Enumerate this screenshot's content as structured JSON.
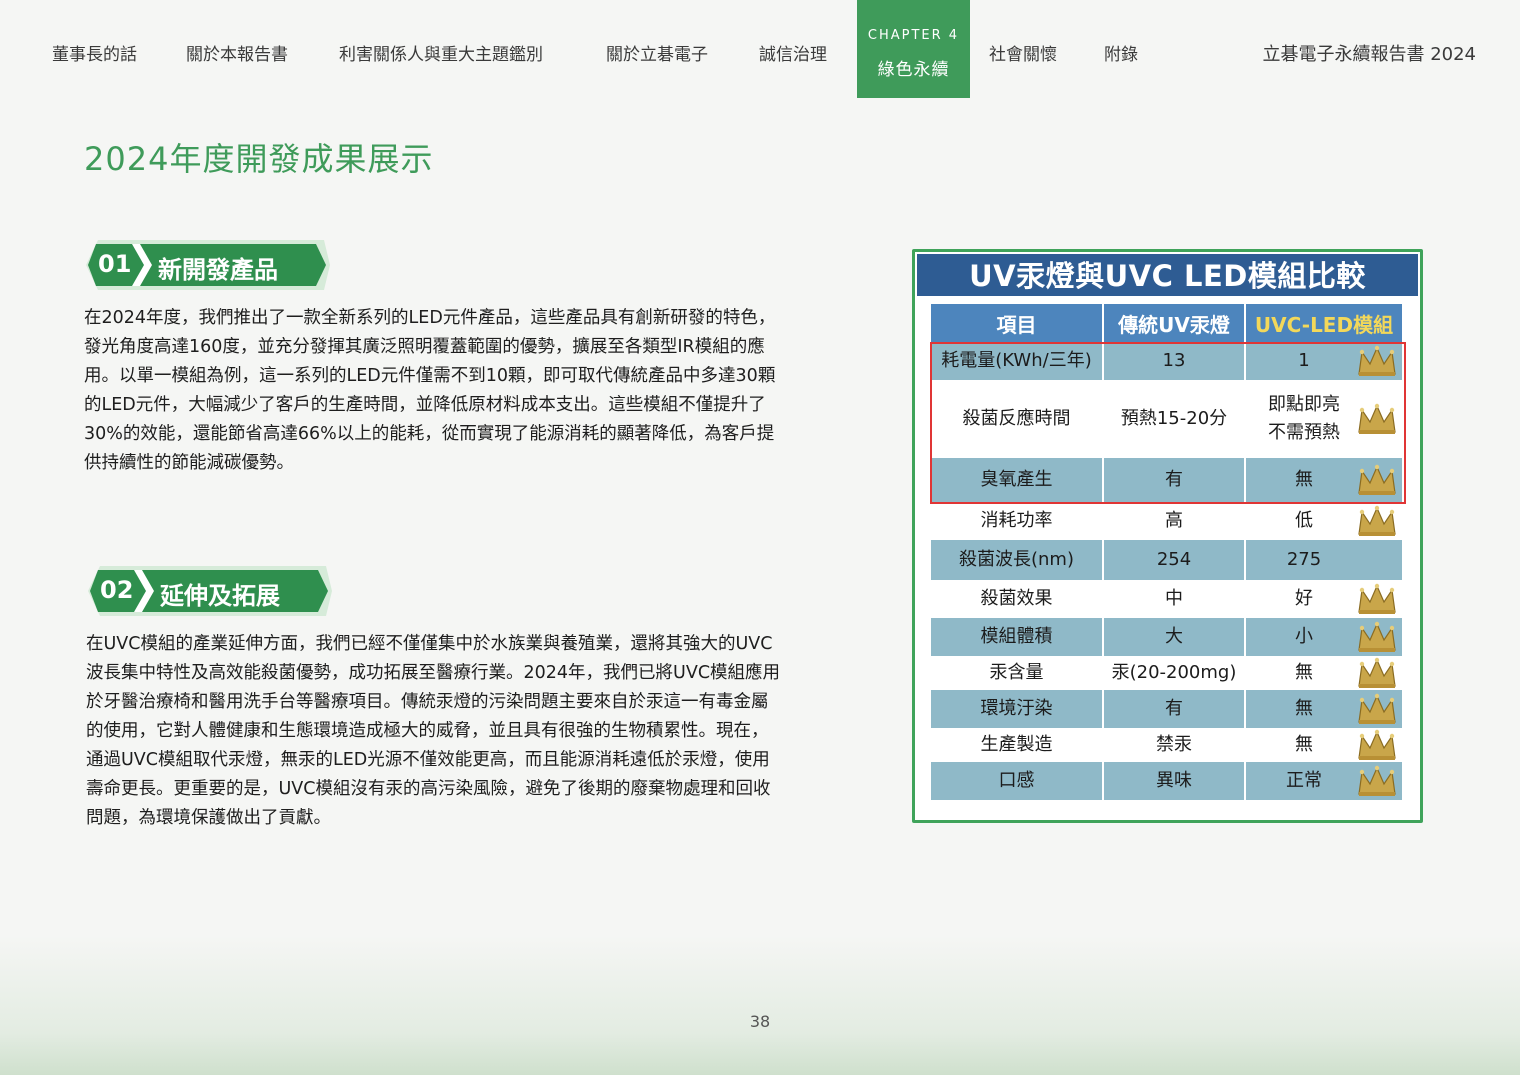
{
  "nav": {
    "items": [
      "董事長的話",
      "關於本報告書",
      "利害關係人與重大主題鑑別",
      "關於立碁電子",
      "誠信治理",
      "社會關懷",
      "附錄"
    ],
    "chapter_small": "CHAPTER 4",
    "chapter_label": "綠色永續",
    "report_title": "立碁電子永續報告書 2024"
  },
  "page_title": "2024年度開發成果展示",
  "sections": [
    {
      "number": "01",
      "label": "新開發產品",
      "lines": [
        "在2024年度，我們推出了一款全新系列的LED元件產品，這些產品具有創新研發的特色，",
        "發光角度高達160度，並充分發揮其廣泛照明覆蓋範圍的優勢，擴展至各類型IR模組的應",
        "用。以單一模組為例，這一系列的LED元件僅需不到10顆，即可取代傳統產品中多達30顆",
        "的LED元件，大幅減少了客戶的生產時間，並降低原材料成本支出。這些模組不僅提升了",
        "30%的效能，還能節省高達66%以上的能耗，從而實現了能源消耗的顯著降低，為客戶提",
        "供持續性的節能減碳優勢。"
      ]
    },
    {
      "number": "02",
      "label": "延伸及拓展",
      "lines": [
        "在UVC模組的產業延伸方面，我們已經不僅僅集中於水族業與養殖業，還將其強大的UVC",
        "波長集中特性及高效能殺菌優勢，成功拓展至醫療行業。2024年，我們已將UVC模組應用",
        "於牙醫治療椅和醫用洗手台等醫療項目。傳統汞燈的污染問題主要來自於汞這一有毒金屬",
        "的使用，它對人體健康和生態環境造成極大的威脅，並且具有很強的生物積累性。現在，",
        "通過UVC模組取代汞燈，無汞的LED光源不僅效能更高，而且能源消耗遠低於汞燈，使用",
        "壽命更長。更重要的是，UVC模組沒有汞的高污染風險，避免了後期的廢棄物處理和回收",
        "問題，為環境保護做出了貢獻。"
      ]
    }
  ],
  "comparison": {
    "title": "UV汞燈與UVC LED模組比較",
    "headers": [
      "項目",
      "傳統UV汞燈",
      "UVC-LED模組"
    ],
    "rows": [
      {
        "item": "耗電量(KWh/三年)",
        "traditional": "13",
        "uvc": "1",
        "crown": true
      },
      {
        "item": "殺菌反應時間",
        "traditional": "預熱15-20分",
        "uvc": "即點即亮\n不需預熱",
        "crown": true
      },
      {
        "item": "臭氧產生",
        "traditional": "有",
        "uvc": "無",
        "crown": true
      },
      {
        "item": "消耗功率",
        "traditional": "高",
        "uvc": "低",
        "crown": true
      },
      {
        "item": "殺菌波長(nm)",
        "traditional": "254",
        "uvc": "275",
        "crown": false
      },
      {
        "item": "殺菌效果",
        "traditional": "中",
        "uvc": "好",
        "crown": true
      },
      {
        "item": "模組體積",
        "traditional": "大",
        "uvc": "小",
        "crown": true
      },
      {
        "item": "汞含量",
        "traditional": "汞(20-200mg)",
        "uvc": "無",
        "crown": true
      },
      {
        "item": "環境汙染",
        "traditional": "有",
        "uvc": "無",
        "crown": true
      },
      {
        "item": "生產製造",
        "traditional": "禁汞",
        "uvc": "無",
        "crown": true
      },
      {
        "item": "口感",
        "traditional": "異味",
        "uvc": "正常",
        "crown": true
      }
    ]
  },
  "colors": {
    "brand_green": "#3f9b5a",
    "table_header": "#4d85bd",
    "table_shade": "#8fb9c8",
    "highlight_box": "#e03535"
  },
  "page_number": "38"
}
